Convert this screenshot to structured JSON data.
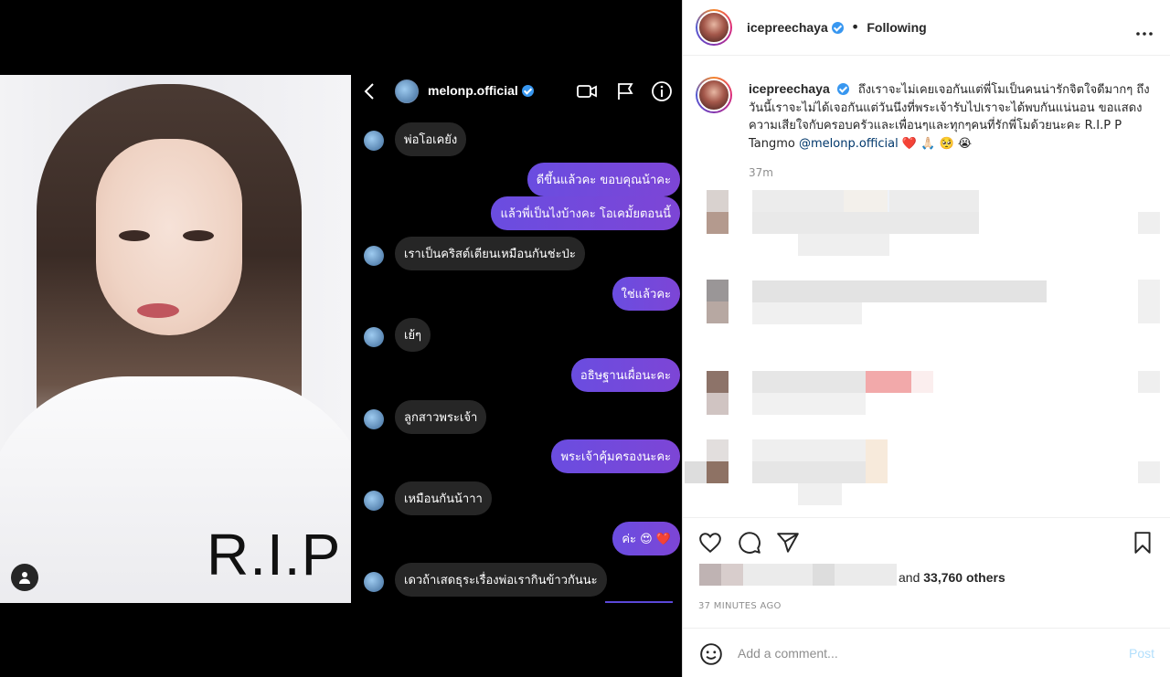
{
  "dm": {
    "username": "melonp.official",
    "messages": [
      {
        "dir": "in",
        "text": "พ่อโอเคยัง"
      },
      {
        "dir": "out",
        "text": "ดีขึ้นแล้วคะ ขอบคุณน้าคะ"
      },
      {
        "dir": "out",
        "text": "แล้วพี่เป็นไงบ้างคะ โอเคมั้ยตอนนี้"
      },
      {
        "dir": "in",
        "text": "เราเป็นคริสต์เตียนเหมือนกันช่ะป่ะ"
      },
      {
        "dir": "out",
        "text": "ใช่แล้วคะ"
      },
      {
        "dir": "in",
        "text": "เย้ๆ"
      },
      {
        "dir": "out",
        "text": "อธิษฐานเผื่อนะคะ"
      },
      {
        "dir": "in",
        "text": "ลูกสาวพระเจ้า"
      },
      {
        "dir": "out",
        "text": "พระเจ้าคุ้มครองนะคะ"
      },
      {
        "dir": "in",
        "text": "เหมือนกันน้าาา"
      },
      {
        "dir": "out",
        "text": "ค่ะ 😍 ❤️"
      },
      {
        "dir": "in",
        "text": "เดวถ้าเสดธุระเรื่องพ่อเรากินข้าวกันนะ"
      }
    ]
  },
  "photo": {
    "overlay_text": "R.I.P"
  },
  "post": {
    "username": "icepreechaya",
    "follow_status": "Following",
    "separator": "•",
    "caption_text": "ถึงเราจะไม่เคยเจอกันแต่พี่โมเป็นคนน่ารักจิตใจดีมากๆ ถึงวันนี้เราจะไม่ได้เจอกันแต่วันนึงที่พระเจ้ารับไปเราจะได้พบกันแน่นอน ขอแสดงความเสียใจกับครอบครัวและเพื่อนๆและทุกๆคนที่รักพี่โมด้วยนะคะ R.I.P P Tangmo",
    "caption_mention": "@melonp.official",
    "caption_emojis": "❤️ 🙏🏻 🥺 😭",
    "caption_time": "37m",
    "likes_prefix": "and",
    "likes_count": "33,760 others",
    "timestamp": "37 MINUTES AGO",
    "comment_placeholder": "Add a comment...",
    "post_label": "Post"
  },
  "icons": {
    "more": "more-dots-icon",
    "like": "heart-icon",
    "comment": "comment-icon",
    "share": "share-icon",
    "save": "bookmark-icon",
    "emoji": "emoji-icon"
  },
  "colors": {
    "dm_outgoing": "#6a4de0",
    "dm_incoming": "#262626",
    "verified": "#3897f0",
    "mention": "#00376b",
    "post_disabled": "#b2dffc"
  }
}
